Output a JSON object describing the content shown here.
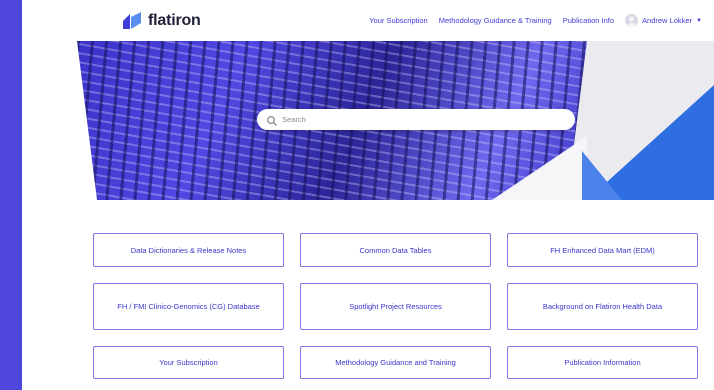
{
  "brand": {
    "name": "flatiron"
  },
  "nav": {
    "items": [
      "Your Subscription",
      "Methodology Guidance & Training",
      "Publication Info"
    ],
    "user_name": "Andrew Lokker"
  },
  "search": {
    "placeholder": "Search"
  },
  "tiles": [
    "Data Dictionaries & Release Notes",
    "Common Data Tables",
    "FH Enhanced Data Mart (EDM)",
    "FH / FMI Clinico-Genomics (CG) Database",
    "Spotlight Project Resources",
    "Background on Flatiron Health Data",
    "Your Subscription",
    "Methodology Guidance and Training",
    "Publication Information"
  ],
  "colors": {
    "accent": "#3f3bd6",
    "page_background": "#4f46dd",
    "hero_blue": "#2f6ee0",
    "tile_border": "#7d79e6"
  }
}
